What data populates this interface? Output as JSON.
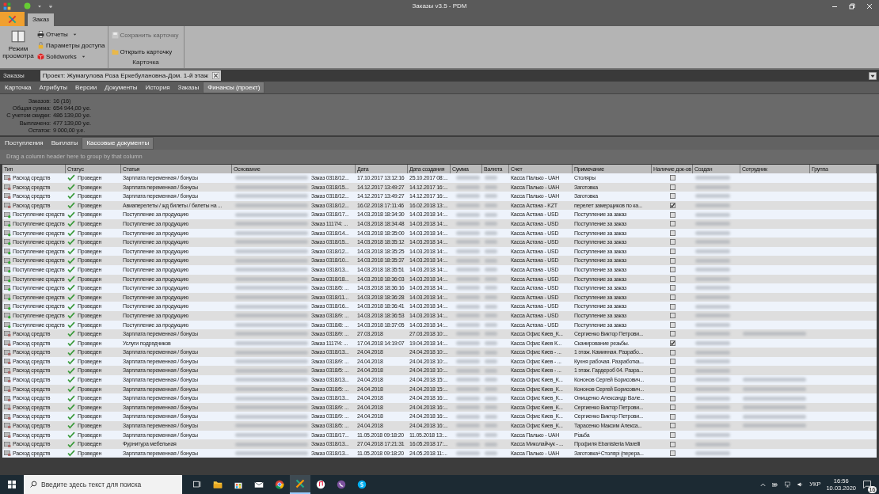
{
  "window": {
    "title": "Заказы v3.5 - PDM"
  },
  "ribbon_tabs": [
    {
      "label": "Заказ",
      "selected": true
    }
  ],
  "ribbon": {
    "view_mode": "Режим просмотра",
    "reports": "Отчеты",
    "access": "Параметры доступа",
    "solidworks": "Solidworks",
    "save_card": {
      "label": "Сохранить карточку",
      "disabled": true
    },
    "open_card": {
      "label": "Открыть карточку",
      "disabled": false
    },
    "group_label": "Карточка"
  },
  "document_tabs": {
    "section": "Заказы",
    "tabs": [
      {
        "label": "Проект: Жумагулова Роза Еркебулановна-Дом. 1-й этаж",
        "selected": true
      }
    ]
  },
  "detail_tabs": [
    {
      "label": "Карточка",
      "selected": false
    },
    {
      "label": "Атрибуты",
      "selected": false
    },
    {
      "label": "Версии",
      "selected": false
    },
    {
      "label": "Документы",
      "selected": false
    },
    {
      "label": "История",
      "selected": false
    },
    {
      "label": "Заказы",
      "selected": false
    },
    {
      "label": "Финансы (проект)",
      "selected": true
    }
  ],
  "summary": [
    {
      "label": "Заказов:",
      "value": "16 (16)"
    },
    {
      "label": "Общая сумма:",
      "value": "654 944,00 у.е."
    },
    {
      "label": "С учетом скидки:",
      "value": "486 139,00 у.е."
    },
    {
      "label": "Выплачено:",
      "value": "477 139,00 у.е."
    },
    {
      "label": "Остаток:",
      "value": "9 000,00 у.е."
    }
  ],
  "sub_tabs": [
    {
      "label": "Поступления",
      "selected": false
    },
    {
      "label": "Выплаты",
      "selected": false
    },
    {
      "label": "Кассовые документы",
      "selected": true
    }
  ],
  "group_panel": "Drag a column header here to group by that column",
  "table": {
    "columns": [
      "Тип",
      "Статус",
      "Статья",
      "Основание",
      "Дата",
      "Дата создания",
      "Сумма",
      "Валюта",
      "Счет",
      "Примечание",
      "Наличие док-ов",
      "Создан",
      "Сотрудник",
      "Группа"
    ],
    "rows": [
      {
        "kind": "expense",
        "type": "Расход средств",
        "status": "Проведен",
        "article": "Зарплата переменная / бонусы",
        "basis": "Заказ 0318/12...",
        "date": "17.10.2017 13:12:16",
        "created": "25.10.2017 08:...",
        "account": "Касса Палько - UAH",
        "note": "Столяры",
        "docs": false,
        "employee_blurred": false
      },
      {
        "kind": "expense",
        "type": "Расход средств",
        "status": "Проведен",
        "article": "Зарплата переменная / бонусы",
        "basis": "Заказ 0318/15...",
        "date": "14.12.2017 13:49:27",
        "created": "14.12.2017 16:...",
        "account": "Касса Палько - UAH",
        "note": "Заготовка",
        "docs": false,
        "employee_blurred": false
      },
      {
        "kind": "expense",
        "type": "Расход средств",
        "status": "Проведен",
        "article": "Зарплата переменная / бонусы",
        "basis": "Заказ 0318/12...",
        "date": "14.12.2017 13:49:27",
        "created": "14.12.2017 16:...",
        "account": "Касса Палько - UAH",
        "note": "Заготовка",
        "docs": false,
        "employee_blurred": false
      },
      {
        "kind": "expense",
        "type": "Расход средств",
        "status": "Проведен",
        "article": "Авиаперелеты / жд билеты / билеты на ...",
        "basis": "Заказ 0318/12...",
        "date": "16.02.2018 17:11:46",
        "created": "16.02.2018 13:...",
        "account": "Касса Астана - KZT",
        "note": "перелет замерщиков по ка...",
        "docs": true,
        "employee_blurred": false
      },
      {
        "kind": "income",
        "type": "Поступление средств",
        "status": "Проведен",
        "article": "Поступление за продукцию",
        "basis": "Заказ 0318/17...",
        "date": "14.03.2018 18:34:30",
        "created": "14.03.2018 14:...",
        "account": "Касса Астана - USD",
        "note": "Поступление за заказ",
        "docs": false,
        "employee_blurred": false
      },
      {
        "kind": "income",
        "type": "Поступление средств",
        "status": "Проведен",
        "article": "Поступление за продукцию",
        "basis": "Заказ 1117/4: ...",
        "date": "14.03.2018 18:34:48",
        "created": "14.03.2018 14:...",
        "account": "Касса Астана - USD",
        "note": "Поступление за заказ",
        "docs": false,
        "employee_blurred": false
      },
      {
        "kind": "income",
        "type": "Поступление средств",
        "status": "Проведен",
        "article": "Поступление за продукцию",
        "basis": "Заказ 0318/14...",
        "date": "14.03.2018 18:35:00",
        "created": "14.03.2018 14:...",
        "account": "Касса Астана - USD",
        "note": "Поступление за заказ",
        "docs": false,
        "employee_blurred": false
      },
      {
        "kind": "income",
        "type": "Поступление средств",
        "status": "Проведен",
        "article": "Поступление за продукцию",
        "basis": "Заказ 0318/15...",
        "date": "14.03.2018 18:35:12",
        "created": "14.03.2018 14:...",
        "account": "Касса Астана - USD",
        "note": "Поступление за заказ",
        "docs": false,
        "employee_blurred": false
      },
      {
        "kind": "income",
        "type": "Поступление средств",
        "status": "Проведен",
        "article": "Поступление за продукцию",
        "basis": "Заказ 0318/12...",
        "date": "14.03.2018 18:35:25",
        "created": "14.03.2018 14:...",
        "account": "Касса Астана - USD",
        "note": "Поступление за заказ",
        "docs": false,
        "employee_blurred": false
      },
      {
        "kind": "income",
        "type": "Поступление средств",
        "status": "Проведен",
        "article": "Поступление за продукцию",
        "basis": "Заказ 0318/10...",
        "date": "14.03.2018 18:35:37",
        "created": "14.03.2018 14:...",
        "account": "Касса Астана - USD",
        "note": "Поступление за заказ",
        "docs": false,
        "employee_blurred": false
      },
      {
        "kind": "income",
        "type": "Поступление средств",
        "status": "Проведен",
        "article": "Поступление за продукцию",
        "basis": "Заказ 0318/13...",
        "date": "14.03.2018 18:35:51",
        "created": "14.03.2018 14:...",
        "account": "Касса Астана - USD",
        "note": "Поступление за заказ",
        "docs": false,
        "employee_blurred": false
      },
      {
        "kind": "income",
        "type": "Поступление средств",
        "status": "Проведен",
        "article": "Поступление за продукцию",
        "basis": "Заказ 0318/18...",
        "date": "14.03.2018 18:36:03",
        "created": "14.03.2018 14:...",
        "account": "Касса Астана - USD",
        "note": "Поступление за заказ",
        "docs": false,
        "employee_blurred": false
      },
      {
        "kind": "income",
        "type": "Поступление средств",
        "status": "Проведен",
        "article": "Поступление за продукцию",
        "basis": "Заказ 0318/5: ...",
        "date": "14.03.2018 18:36:16",
        "created": "14.03.2018 14:...",
        "account": "Касса Астана - USD",
        "note": "Поступление за заказ",
        "docs": false,
        "employee_blurred": false
      },
      {
        "kind": "income",
        "type": "Поступление средств",
        "status": "Проведен",
        "article": "Поступление за продукцию",
        "basis": "Заказ 0318/11...",
        "date": "14.03.2018 18:36:28",
        "created": "14.03.2018 14:...",
        "account": "Касса Астана - USD",
        "note": "Поступление за заказ",
        "docs": false,
        "employee_blurred": false
      },
      {
        "kind": "income",
        "type": "Поступление средств",
        "status": "Проведен",
        "article": "Поступление за продукцию",
        "basis": "Заказ 0318/16...",
        "date": "14.03.2018 18:36:41",
        "created": "14.03.2018 14:...",
        "account": "Касса Астана - USD",
        "note": "Поступление за заказ",
        "docs": false,
        "employee_blurred": false
      },
      {
        "kind": "income",
        "type": "Поступление средств",
        "status": "Проведен",
        "article": "Поступление за продукцию",
        "basis": "Заказ 0318/9: ...",
        "date": "14.03.2018 18:36:53",
        "created": "14.03.2018 14:...",
        "account": "Касса Астана - USD",
        "note": "Поступление за заказ",
        "docs": false,
        "employee_blurred": false
      },
      {
        "kind": "income",
        "type": "Поступление средств",
        "status": "Проведен",
        "article": "Поступление за продукцию",
        "basis": "Заказ 0318/8: ...",
        "date": "14.03.2018 18:37:05",
        "created": "14.03.2018 14:...",
        "account": "Касса Астана - USD",
        "note": "Поступление за заказ",
        "docs": false,
        "employee_blurred": false
      },
      {
        "kind": "expense",
        "type": "Расход средств",
        "status": "Проведен",
        "article": "Зарплата переменная / бонусы",
        "basis": "Заказ 0318/9: ...",
        "date": "27.03.2018",
        "created": "27.03.2018 10:...",
        "account": "Касса Офис Киев_К...",
        "note": "Сергиенко Виктор Петрови...",
        "docs": false,
        "employee_blurred": true
      },
      {
        "kind": "expense",
        "type": "Расход средств",
        "status": "Проведен",
        "article": "Услуги подрядчиков",
        "basis": "Заказ 1117/4: ...",
        "date": "17.04.2018 14:19:07",
        "created": "19.04.2018 14:...",
        "account": "Касса Офис Киев К...",
        "note": "Сканирование резьбы.",
        "docs": true,
        "employee_blurred": false
      },
      {
        "kind": "expense",
        "type": "Расход средств",
        "status": "Проведен",
        "article": "Зарплата переменная / бонусы",
        "basis": "Заказ 0318/13...",
        "date": "24.04.2018",
        "created": "24.04.2018 10:...",
        "account": "Касса Офис Киев - ...",
        "note": "1 этаж. Каминная. Разрабо...",
        "docs": false,
        "employee_blurred": false
      },
      {
        "kind": "expense",
        "type": "Расход средств",
        "status": "Проведен",
        "article": "Зарплата переменная / бонусы",
        "basis": "Заказ 0318/9: ...",
        "date": "24.04.2018",
        "created": "24.04.2018 10:...",
        "account": "Касса Офис Киев - ...",
        "note": "Кухня рабочая. Разработка...",
        "docs": false,
        "employee_blurred": false
      },
      {
        "kind": "expense",
        "type": "Расход средств",
        "status": "Проведен",
        "article": "Зарплата переменная / бонусы",
        "basis": "Заказ 0318/5: ...",
        "date": "24.04.2018",
        "created": "24.04.2018 10:...",
        "account": "Касса Офис Киев - ...",
        "note": "1 этаж. Гардероб 04. Разра...",
        "docs": false,
        "employee_blurred": false
      },
      {
        "kind": "expense",
        "type": "Расход средств",
        "status": "Проведен",
        "article": "Зарплата переменная / бонусы",
        "basis": "Заказ 0318/13...",
        "date": "24.04.2018",
        "created": "24.04.2018 15:...",
        "account": "Касса Офис Киев_К...",
        "note": "Кононов Сергей Борисович...",
        "docs": false,
        "employee_blurred": true
      },
      {
        "kind": "expense",
        "type": "Расход средств",
        "status": "Проведен",
        "article": "Зарплата переменная / бонусы",
        "basis": "Заказ 0318/5: ...",
        "date": "24.04.2018",
        "created": "24.04.2018 15:...",
        "account": "Касса Офис Киев_К...",
        "note": "Кононов Сергей Борисович...",
        "docs": false,
        "employee_blurred": true
      },
      {
        "kind": "expense",
        "type": "Расход средств",
        "status": "Проведен",
        "article": "Зарплата переменная / бонусы",
        "basis": "Заказ 0318/13...",
        "date": "24.04.2018",
        "created": "24.04.2018 16:...",
        "account": "Касса Офис Киев_К...",
        "note": "Онищенко Александр Вале...",
        "docs": false,
        "employee_blurred": true
      },
      {
        "kind": "expense",
        "type": "Расход средств",
        "status": "Проведен",
        "article": "Зарплата переменная / бонусы",
        "basis": "Заказ 0318/9: ...",
        "date": "24.04.2018",
        "created": "24.04.2018 16:...",
        "account": "Касса Офис Киев_К...",
        "note": "Сергиенко Виктор Петрови...",
        "docs": false,
        "employee_blurred": true
      },
      {
        "kind": "expense",
        "type": "Расход средств",
        "status": "Проведен",
        "article": "Зарплата переменная / бонусы",
        "basis": "Заказ 0318/9: ...",
        "date": "24.04.2018",
        "created": "24.04.2018 16:...",
        "account": "Касса Офис Киев_К...",
        "note": "Сергиенко Виктор Петрови...",
        "docs": false,
        "employee_blurred": true
      },
      {
        "kind": "expense",
        "type": "Расход средств",
        "status": "Проведен",
        "article": "Зарплата переменная / бонусы",
        "basis": "Заказ 0318/5: ...",
        "date": "24.04.2018",
        "created": "24.04.2018 16:...",
        "account": "Касса Офис Киев_К...",
        "note": "Тарасенко Максим Алекса...",
        "docs": false,
        "employee_blurred": true
      },
      {
        "kind": "expense",
        "type": "Расход средств",
        "status": "Проведен",
        "article": "Зарплата переменная / бонусы",
        "basis": "Заказ 0318/17...",
        "date": "11.05.2018 09:18:20",
        "created": "11.05.2018 13:...",
        "account": "Касса Палько - UAH",
        "note": "Різьба",
        "docs": false,
        "employee_blurred": false
      },
      {
        "kind": "expense",
        "type": "Расход средств",
        "status": "Проведен",
        "article": "Фурнитура мебельная",
        "basis": "Заказ 0318/13...",
        "date": "27.04.2018 17:21:31",
        "created": "16.05.2018 17:...",
        "account": "Касса Миколайчук - ...",
        "note": "Профиля Ebanisteria Marelli",
        "docs": false,
        "employee_blurred": false
      },
      {
        "kind": "expense",
        "type": "Расход средств",
        "status": "Проведен",
        "article": "Зарплата переменная / бонусы",
        "basis": "Заказ 0318/13...",
        "date": "11.05.2018 09:18:20",
        "created": "24.05.2018 11:...",
        "account": "Касса Палько - UAH",
        "note": "Заготовка+Столярі (перера...",
        "docs": false,
        "employee_blurred": false
      }
    ]
  },
  "taskbar": {
    "search_placeholder": "Введите здесь текст для поиска",
    "language": "УКР",
    "time": "16:56",
    "date": "10.03.2020",
    "notifications": "16"
  }
}
